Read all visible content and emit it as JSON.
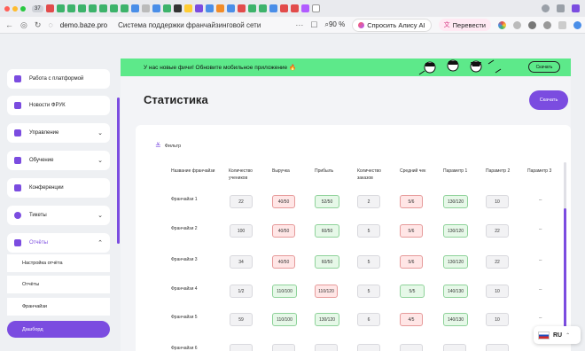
{
  "browser": {
    "tab_count": "37",
    "url": "demo.baze.pro",
    "page_title": "Система поддержки франчайзинговой сети",
    "zoom": "90 %",
    "alice_label": "Спросить Алису AI",
    "translate_label": "Перевести"
  },
  "sidebar": {
    "items": [
      {
        "label": "Работа с платформой",
        "icon": "platform-icon"
      },
      {
        "label": "Новости ФРУК",
        "icon": "megaphone-icon"
      },
      {
        "label": "Управление",
        "icon": "gear-icon"
      },
      {
        "label": "Обучение",
        "icon": "book-icon"
      },
      {
        "label": "Конференции",
        "icon": "video-icon"
      },
      {
        "label": "Тикеты",
        "icon": "chat-icon"
      },
      {
        "label": "Отчёты",
        "icon": "report-icon"
      }
    ],
    "subitems": [
      "Настройка отчёта",
      "Отчёты",
      "Франчайзи",
      "Дашборд"
    ]
  },
  "banner": {
    "text": "У нас новые фичи! Обновите мобильное приложение 🔥",
    "button": "Скачать"
  },
  "page": {
    "title": "Статистика",
    "download_button": "Скачать",
    "filter_label": "Фильтр"
  },
  "table": {
    "headers": [
      "Название франчайзи",
      "Количество учеников",
      "Выручка",
      "Прибыль",
      "Количество заказов",
      "Средний чек",
      "Параметр 1",
      "Параметр 2",
      "Параметр 3"
    ],
    "rows": [
      {
        "name": "Франчайзи 1",
        "cells": [
          "22",
          "40/50",
          "52/50",
          "2",
          "5/6",
          "130/120",
          "10",
          "–"
        ]
      },
      {
        "name": "Франчайзи 2",
        "cells": [
          "100",
          "40/50",
          "60/50",
          "5",
          "5/6",
          "130/120",
          "22",
          "–"
        ]
      },
      {
        "name": "Франчайзи 3",
        "cells": [
          "34",
          "40/50",
          "60/50",
          "5",
          "5/6",
          "130/120",
          "22",
          "–"
        ]
      },
      {
        "name": "Франчайзи 4",
        "cells": [
          "1/2",
          "110/100",
          "110/120",
          "5",
          "5/5",
          "140/130",
          "10",
          "–"
        ]
      },
      {
        "name": "Франчайзи 5",
        "cells": [
          "59",
          "110/100",
          "130/120",
          "6",
          "4/5",
          "140/130",
          "10",
          "–"
        ]
      },
      {
        "name": "Франчайзи 6",
        "cells": [
          "",
          "",
          "",
          "",
          "",
          "",
          "",
          ""
        ]
      }
    ],
    "cell_styles": [
      [
        "g",
        "r",
        "gr",
        "g",
        "r",
        "gr",
        "g",
        "dash"
      ],
      [
        "g",
        "r",
        "gr",
        "g",
        "r",
        "gr",
        "g",
        "dash"
      ],
      [
        "g",
        "r",
        "gr",
        "g",
        "r",
        "gr",
        "g",
        "dash"
      ],
      [
        "g",
        "gr",
        "r",
        "g",
        "gr",
        "gr",
        "g",
        "dash"
      ],
      [
        "g",
        "gr",
        "gr",
        "g",
        "r",
        "gr",
        "g",
        "dash"
      ],
      [
        "g",
        "g",
        "g",
        "g",
        "g",
        "g",
        "g",
        "dash"
      ]
    ]
  },
  "language": {
    "code": "RU"
  },
  "colors": {
    "accent": "#7b4ce0",
    "banner": "#5de98a"
  }
}
